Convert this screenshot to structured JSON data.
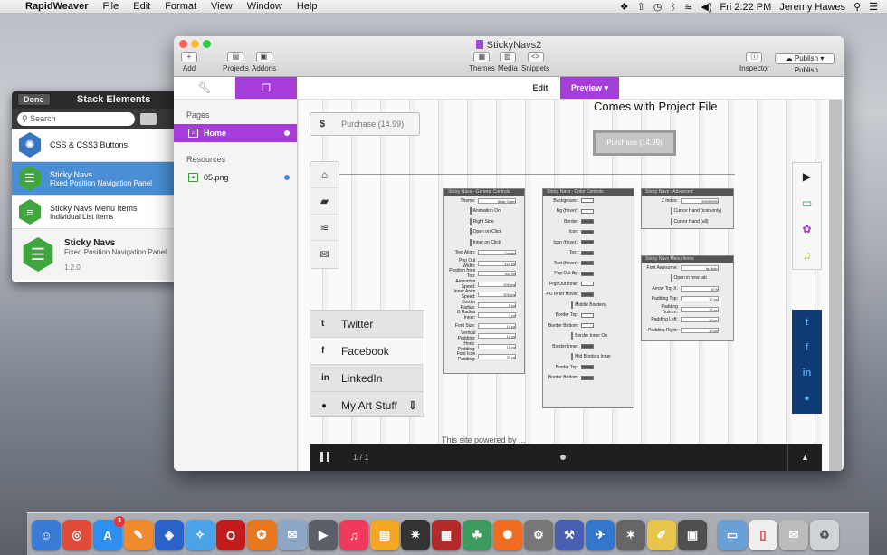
{
  "menubar": {
    "app": "RapidWeaver",
    "items": [
      "File",
      "Edit",
      "Format",
      "View",
      "Window",
      "Help"
    ],
    "clock": "Fri 2:22 PM",
    "user": "Jeremy Hawes"
  },
  "stack_panel": {
    "done": "Done",
    "title": "Stack Elements",
    "search_placeholder": "Search",
    "items": [
      {
        "name": "CSS & CSS3 Buttons",
        "desc": ""
      },
      {
        "name": "Sticky Navs",
        "desc": "Fixed Position Navigation Panel"
      },
      {
        "name": "Sticky Navs Menu Items",
        "desc": "Individual List Items"
      }
    ],
    "detail": {
      "name": "Sticky Navs",
      "desc": "Fixed Position Navigation Panel",
      "version": "1.2.0"
    }
  },
  "window": {
    "title": "StickyNavs2",
    "toolbar": {
      "add": "Add",
      "projects": "Projects",
      "addons": "Addons",
      "themes": "Themes",
      "media": "Media",
      "snippets": "Snippets",
      "inspector": "Inspector",
      "publish_btn": "Publish",
      "publish": "Publish"
    },
    "tabs": {
      "edit": "Edit",
      "preview": "Preview"
    },
    "sidebar": {
      "pages_header": "Pages",
      "home": "Home",
      "resources_header": "Resources",
      "resource": "05.png"
    }
  },
  "preview": {
    "headline": "Comes with Project File",
    "purchase_left": "Purchase (14.99)",
    "purchase_center": "Purchase (14.99)",
    "social": [
      "Twitter",
      "Facebook",
      "LinkedIn",
      "My Art Stuff"
    ],
    "player": {
      "page": "1 / 1"
    },
    "footer": "This site powered by ..."
  },
  "panels": {
    "general": {
      "title": "Sticky Navs - General Controls",
      "rows": [
        "Theme:",
        "Animation On",
        "Right Side",
        "Open on Click",
        "Inner on Click",
        "Text Align:",
        "Pop Out Width:",
        "Position from Top:",
        "Animation Speed:",
        "Inner Anim Speed:",
        "Border Radius:",
        "B Radius Inner:",
        "Font Size:",
        "Vertical Padding:",
        "Horiz. Padding:",
        "Font Icon Padding:"
      ],
      "values": [
        "Slide Open",
        "",
        "",
        "",
        "",
        "Center",
        "120 px",
        "300 px",
        "200 ms",
        "200 ms",
        "5 px",
        "3 px",
        "14 px",
        "12 px",
        "15 px",
        "25 px"
      ]
    },
    "color": {
      "title": "Sticky Navs - Color Controls",
      "rows": [
        "Background:",
        "Bg (hover):",
        "Border:",
        "Icon:",
        "Icon (hover):",
        "Text:",
        "Text (hover):",
        "Pop Out Bg:",
        "Pop Out Inner:",
        "PO Inner Hover:",
        "Middle Borders",
        "Border Top:",
        "Border Bottom:",
        "Border Inner On",
        "Border Inner:",
        "Mid Borders Inner",
        "Border Top:",
        "Border Bottom:"
      ]
    },
    "advanced": {
      "title": "Sticky Navs - Advanced",
      "rows": [
        "Z Index:",
        "Cursor Hand (icon only)",
        "Cursor Hand (all)"
      ],
      "zindex": "99999999"
    },
    "menu": {
      "title": "Sticky Navs Menu Items",
      "rows": [
        "Font Awesome:",
        "Open in new tab",
        "Arrow Top X:",
        "Padding Top:",
        "Padding Bottom:",
        "Padding Left:",
        "Padding Right:"
      ],
      "values": [
        "fa-flickr",
        "",
        "50 ft",
        "12 px",
        "12 px",
        "10 px",
        "10 px"
      ]
    }
  }
}
